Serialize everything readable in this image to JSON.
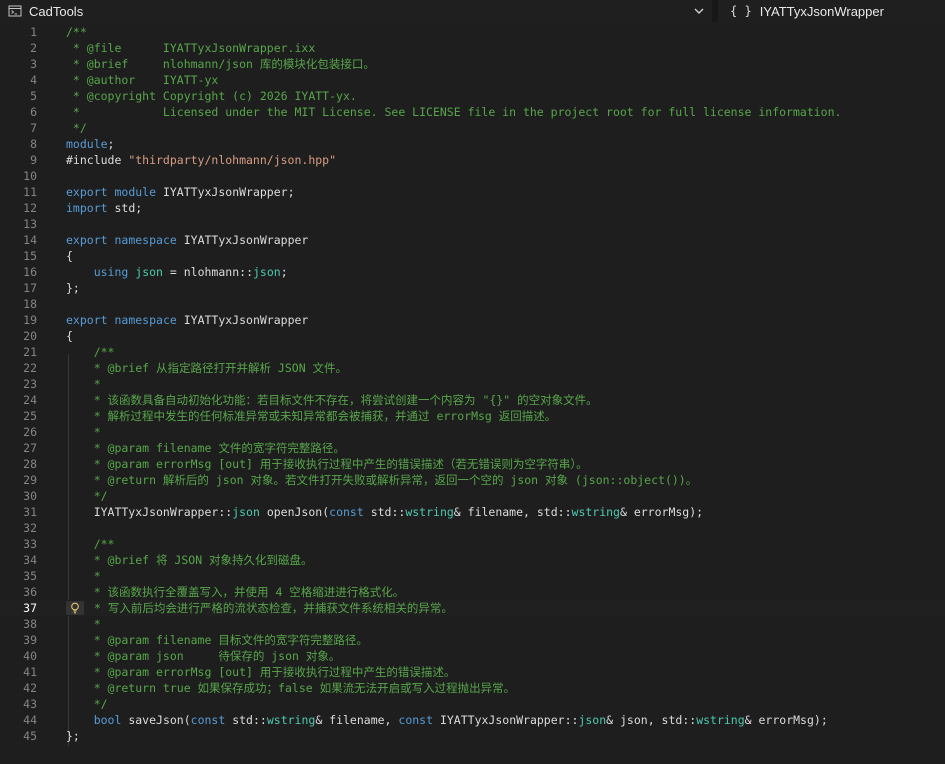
{
  "toolbar": {
    "project_label": "CadTools",
    "project_icon": "project-icon",
    "member_label": "IYATTyxJsonWrapper",
    "member_glyph": "{ }"
  },
  "editor": {
    "active_line": 37,
    "lines": [
      {
        "n": "1",
        "seg": [
          [
            "/**",
            "cm"
          ]
        ]
      },
      {
        "n": "2",
        "seg": [
          [
            " * @file      IYATTyxJsonWrapper.ixx",
            "cm"
          ]
        ]
      },
      {
        "n": "3",
        "seg": [
          [
            " * @brief     nlohmann/json 库的模块化包装接口。",
            "cm"
          ]
        ]
      },
      {
        "n": "4",
        "seg": [
          [
            " * @author    IYATT-yx",
            "cm"
          ]
        ]
      },
      {
        "n": "5",
        "seg": [
          [
            " * @copyright Copyright (c) 2026 IYATT-yx.",
            "cm"
          ]
        ]
      },
      {
        "n": "6",
        "seg": [
          [
            " *            Licensed under the MIT License. See LICENSE file in the project root for full license information.",
            "cm"
          ]
        ]
      },
      {
        "n": "7",
        "seg": [
          [
            " */",
            "cm"
          ]
        ]
      },
      {
        "n": "8",
        "seg": [
          [
            "module",
            "kw"
          ],
          [
            ";",
            "tx"
          ]
        ]
      },
      {
        "n": "9",
        "seg": [
          [
            "#include ",
            "tx"
          ],
          [
            "\"thirdparty/nlohmann/json.hpp\"",
            "st"
          ]
        ]
      },
      {
        "n": "10",
        "seg": []
      },
      {
        "n": "11",
        "seg": [
          [
            "export",
            "kw"
          ],
          [
            " ",
            "tx"
          ],
          [
            "module",
            "kw"
          ],
          [
            " IYATTyxJsonWrapper;",
            "tx"
          ]
        ]
      },
      {
        "n": "12",
        "seg": [
          [
            "import",
            "kw"
          ],
          [
            " std;",
            "tx"
          ]
        ]
      },
      {
        "n": "13",
        "seg": []
      },
      {
        "n": "14",
        "seg": [
          [
            "export",
            "kw"
          ],
          [
            " ",
            "tx"
          ],
          [
            "namespace",
            "kw"
          ],
          [
            " IYATTyxJsonWrapper",
            "tx"
          ]
        ]
      },
      {
        "n": "15",
        "seg": [
          [
            "{",
            "tx"
          ]
        ]
      },
      {
        "n": "16",
        "seg": [
          [
            "    ",
            "tx"
          ],
          [
            "using",
            "kw"
          ],
          [
            " ",
            "tx"
          ],
          [
            "json",
            "ty"
          ],
          [
            " = nlohmann",
            "tx"
          ],
          [
            "::",
            "tx"
          ],
          [
            "json",
            "ty"
          ],
          [
            ";",
            "tx"
          ]
        ]
      },
      {
        "n": "17",
        "seg": [
          [
            "};",
            "tx"
          ]
        ]
      },
      {
        "n": "18",
        "seg": []
      },
      {
        "n": "19",
        "seg": [
          [
            "export",
            "kw"
          ],
          [
            " ",
            "tx"
          ],
          [
            "namespace",
            "kw"
          ],
          [
            " IYATTyxJsonWrapper",
            "tx"
          ]
        ]
      },
      {
        "n": "20",
        "seg": [
          [
            "{",
            "tx"
          ]
        ]
      },
      {
        "n": "21",
        "seg": [
          [
            "    /**",
            "cm"
          ]
        ]
      },
      {
        "n": "22",
        "seg": [
          [
            "    * @brief 从指定路径打开并解析 JSON 文件。",
            "cm"
          ]
        ]
      },
      {
        "n": "23",
        "seg": [
          [
            "    *",
            "cm"
          ]
        ]
      },
      {
        "n": "24",
        "seg": [
          [
            "    * 该函数具备自动初始化功能：若目标文件不存在，将尝试创建一个内容为 \"{}\" 的空对象文件。",
            "cm"
          ]
        ]
      },
      {
        "n": "25",
        "seg": [
          [
            "    * 解析过程中发生的任何标准异常或未知异常都会被捕获，并通过 errorMsg 返回描述。",
            "cm"
          ]
        ]
      },
      {
        "n": "26",
        "seg": [
          [
            "    *",
            "cm"
          ]
        ]
      },
      {
        "n": "27",
        "seg": [
          [
            "    * @param filename 文件的宽字符完整路径。",
            "cm"
          ]
        ]
      },
      {
        "n": "28",
        "seg": [
          [
            "    * @param errorMsg [out] 用于接收执行过程中产生的错误描述（若无错误则为空字符串）。",
            "cm"
          ]
        ]
      },
      {
        "n": "29",
        "seg": [
          [
            "    * @return 解析后的 json 对象。若文件打开失败或解析异常，返回一个空的 json 对象 (json::object())。",
            "cm"
          ]
        ]
      },
      {
        "n": "30",
        "seg": [
          [
            "    */",
            "cm"
          ]
        ]
      },
      {
        "n": "31",
        "seg": [
          [
            "    IYATTyxJsonWrapper",
            "tx"
          ],
          [
            "::",
            "tx"
          ],
          [
            "json",
            "ty"
          ],
          [
            " openJson(",
            "tx"
          ],
          [
            "const",
            "kw"
          ],
          [
            " std",
            "tx"
          ],
          [
            "::",
            "tx"
          ],
          [
            "wstring",
            "ty"
          ],
          [
            "& filename, std",
            "tx"
          ],
          [
            "::",
            "tx"
          ],
          [
            "wstring",
            "ty"
          ],
          [
            "& errorMsg);",
            "tx"
          ]
        ]
      },
      {
        "n": "32",
        "seg": []
      },
      {
        "n": "33",
        "seg": [
          [
            "    /**",
            "cm"
          ]
        ]
      },
      {
        "n": "34",
        "seg": [
          [
            "    * @brief 将 JSON 对象持久化到磁盘。",
            "cm"
          ]
        ]
      },
      {
        "n": "35",
        "seg": [
          [
            "    *",
            "cm"
          ]
        ]
      },
      {
        "n": "36",
        "seg": [
          [
            "    * 该函数执行全覆盖写入，并使用 4 空格缩进进行格式化。",
            "cm"
          ]
        ]
      },
      {
        "n": "37",
        "seg": [
          [
            "    * 写入前后均会进行严格的流状态检查，并捕获文件系统相关的异常。",
            "cm"
          ]
        ]
      },
      {
        "n": "38",
        "seg": [
          [
            "    *",
            "cm"
          ]
        ]
      },
      {
        "n": "39",
        "seg": [
          [
            "    * @param filename 目标文件的宽字符完整路径。",
            "cm"
          ]
        ]
      },
      {
        "n": "40",
        "seg": [
          [
            "    * @param json     待保存的 json 对象。",
            "cm"
          ]
        ]
      },
      {
        "n": "41",
        "seg": [
          [
            "    * @param errorMsg [out] 用于接收执行过程中产生的错误描述。",
            "cm"
          ]
        ]
      },
      {
        "n": "42",
        "seg": [
          [
            "    * @return true 如果保存成功；false 如果流无法开启或写入过程抛出异常。",
            "cm"
          ]
        ]
      },
      {
        "n": "43",
        "seg": [
          [
            "    */",
            "cm"
          ]
        ]
      },
      {
        "n": "44",
        "seg": [
          [
            "    ",
            "tx"
          ],
          [
            "bool",
            "kw"
          ],
          [
            " saveJson(",
            "tx"
          ],
          [
            "const",
            "kw"
          ],
          [
            " std",
            "tx"
          ],
          [
            "::",
            "tx"
          ],
          [
            "wstring",
            "ty"
          ],
          [
            "& filename, ",
            "tx"
          ],
          [
            "const",
            "kw"
          ],
          [
            " IYATTyxJsonWrapper",
            "tx"
          ],
          [
            "::",
            "tx"
          ],
          [
            "json",
            "ty"
          ],
          [
            "& json, std",
            "tx"
          ],
          [
            "::",
            "tx"
          ],
          [
            "wstring",
            "ty"
          ],
          [
            "& errorMsg);",
            "tx"
          ]
        ]
      },
      {
        "n": "45",
        "seg": [
          [
            "};",
            "tx"
          ]
        ]
      }
    ]
  },
  "colors": {
    "cm": "#57a64a",
    "kw": "#569cd6",
    "st": "#d69d85",
    "ty": "#4ec9b0",
    "tx": "#dcdcdc",
    "line_number": "#858585",
    "background": "#1e1e1e"
  }
}
